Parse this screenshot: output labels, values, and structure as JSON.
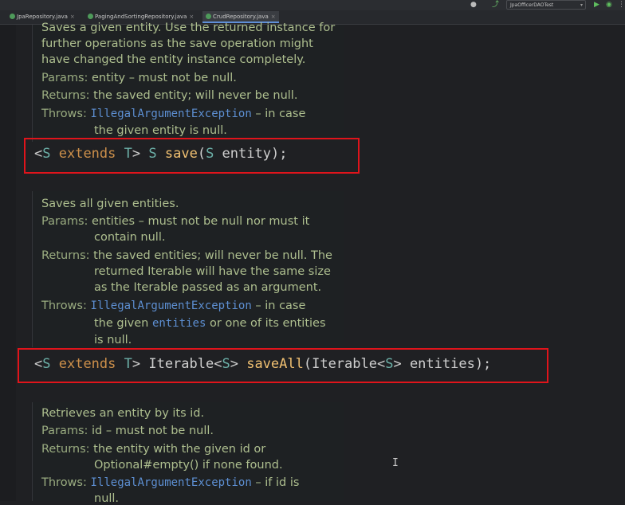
{
  "tabs": [
    {
      "label": "JpaRepository.java"
    },
    {
      "label": "PagingAndSortingRepository.java"
    },
    {
      "label": "CrudRepository.java"
    }
  ],
  "run_config": "JpaOfficerDAOTest",
  "docs": {
    "save": {
      "lines": [
        "Saves a given entity. Use the returned instance for",
        "further operations as the save operation might",
        "have changed the entity instance completely."
      ],
      "params_key": "Params:",
      "params": "entity – must not be null.",
      "returns_key": "Returns:",
      "returns": "the saved entity; will never be null.",
      "throws_key": "Throws:",
      "throws_link": "IllegalArgumentException",
      "throws_rest": " – in case",
      "throws_cont": "the given entity is null."
    },
    "saveAll": {
      "summary": "Saves all given entities.",
      "params_key": "Params:",
      "params": "entities – must not be null nor must it",
      "params_cont": "contain null.",
      "returns_key": "Returns:",
      "returns": "the saved entities; will never be null. The",
      "returns_cont1": "returned Iterable will have the same size",
      "returns_cont2": "as the Iterable passed as an argument.",
      "throws_key": "Throws:",
      "throws_link": "IllegalArgumentException",
      "throws_rest": " – in case",
      "throws_cont_a": "the given ",
      "throws_cont_link": "entities",
      "throws_cont_b": " or one of its entities",
      "throws_cont2": "is null."
    },
    "findById": {
      "summary": "Retrieves an entity by its id.",
      "params_key": "Params:",
      "params": "id – must not be null.",
      "returns_key": "Returns:",
      "returns": "the entity with the given id or",
      "returns_cont": "Optional#empty() if none found.",
      "throws_key": "Throws:",
      "throws_link": "IllegalArgumentException",
      "throws_rest": " – if id is",
      "throws_cont": "null."
    }
  },
  "code": {
    "save": {
      "p1": "<",
      "s1": "S",
      "kw": " extends ",
      "t": "T",
      "p2": "> ",
      "s2": "S",
      "sp": " ",
      "fn": "save",
      "p3": "(",
      "s3": "S",
      "p4": " entity);"
    },
    "saveAll": {
      "p1": "<",
      "s1": "S",
      "kw": " extends ",
      "t": "T",
      "p2": "> Iterable<",
      "s2": "S",
      "p3": "> ",
      "fn": "saveAll",
      "p4": "(Iterable<",
      "s3": "S",
      "p5": "> entities);"
    }
  },
  "cursor_glyph": "I"
}
